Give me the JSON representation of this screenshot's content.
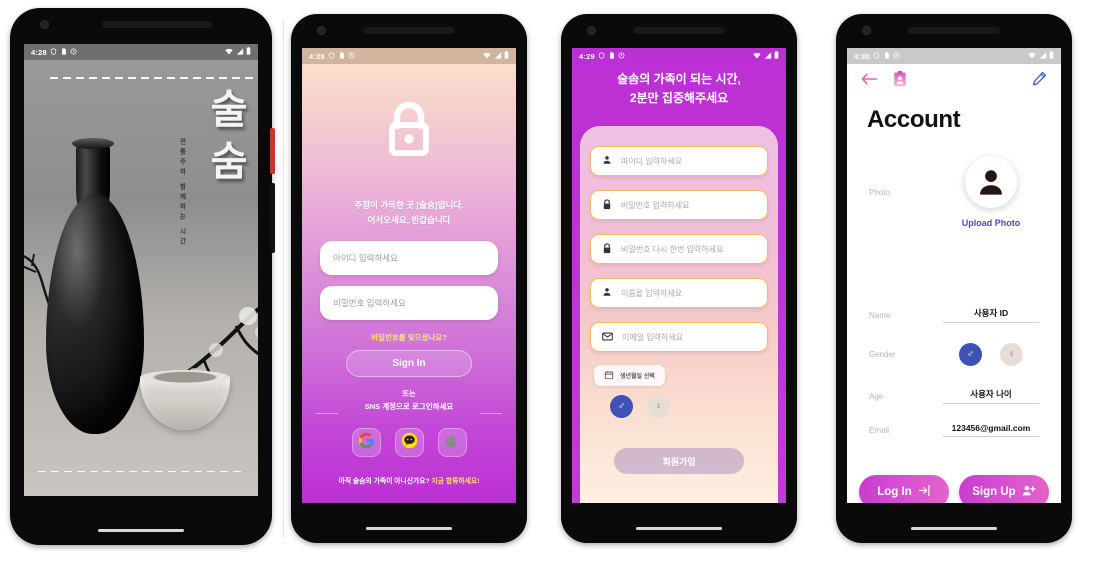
{
  "theme": {
    "accent_magenta": "#bb2fd4",
    "accent_pink": "#e463c8",
    "accent_gold": "#f6bf56",
    "link_blue": "#4a48c4",
    "male_blue": "#3f51b5",
    "female_beige": "#e8ddd6"
  },
  "phone1": {
    "name": "splash-screen",
    "status": {
      "time": "4:28",
      "icons": [
        "shield-icon",
        "sim-icon",
        "sync-icon"
      ],
      "right_icons": [
        "wifi-icon",
        "signal-icon",
        "battery-icon"
      ]
    },
    "brand_title": "술숨",
    "brand_subtitle": "전통주와 함께하는 시간"
  },
  "phone2": {
    "name": "sign-in-screen",
    "status": {
      "time": "4:28",
      "icons": [
        "shield-icon",
        "sim-icon",
        "sync-icon"
      ],
      "right_icons": [
        "wifi-icon",
        "signal-icon",
        "battery-icon"
      ]
    },
    "lock_icon": "lock-icon",
    "welcome_line1": "주향이 가득한 곳 [술숨]입니다.",
    "welcome_line2": "어서오세요, 반갑습니다",
    "id_placeholder": "아이디 입력하세요",
    "pw_placeholder": "비밀번호 입력하세요",
    "forgot_password": "비밀번호를 잊으셨나요?",
    "sign_in_button": "Sign In",
    "or_text": "또는",
    "sns_text": "SNS 계정으로 로그인하세요",
    "social_buttons": [
      {
        "name": "google-icon",
        "label": "Google"
      },
      {
        "name": "kakao-icon",
        "label": "Kakao"
      },
      {
        "name": "apple-icon",
        "label": "Apple"
      }
    ],
    "join_prompt": "아직 술숨의 가족이 아니신가요? ",
    "join_link": "지금 합류하세요!"
  },
  "phone3": {
    "name": "sign-up-screen",
    "status": {
      "time": "4:29",
      "icons": [
        "shield-icon",
        "sim-icon",
        "sync-icon"
      ],
      "right_icons": [
        "wifi-icon",
        "signal-icon",
        "battery-icon"
      ]
    },
    "header_line1": "술솜의 가족이 되는 시간,",
    "header_line2": "2분만 집중해주세요",
    "fields": [
      {
        "icon": "person-icon",
        "placeholder": "마이디 입력하세요"
      },
      {
        "icon": "lock-icon",
        "placeholder": "비밀번호 입력하세요"
      },
      {
        "icon": "lock-icon",
        "placeholder": "비밀번호 다시 한번 입력하세요"
      },
      {
        "icon": "person-icon",
        "placeholder": "이름을 입력하세요"
      },
      {
        "icon": "mail-icon",
        "placeholder": "이메일 입력하세요"
      }
    ],
    "date_button": "생년월일 선택",
    "date_icon": "calendar-icon",
    "gender_male": "♂",
    "gender_female": "♀",
    "submit_button": "회원가입"
  },
  "phone4": {
    "name": "account-screen",
    "status": {
      "time": "4:30",
      "icons": [
        "shield-icon",
        "sim-icon",
        "sync-icon"
      ],
      "right_icons": [
        "wifi-icon",
        "signal-icon",
        "battery-icon"
      ]
    },
    "back_icon": "back-arrow-icon",
    "badge_icon": "id-card-icon",
    "edit_icon": "pencil-edit-icon",
    "title": "Account",
    "photo_label": "Photo",
    "avatar_icon": "person-avatar-icon",
    "upload_photo": "Upload Photo",
    "rows": [
      {
        "label": "Name",
        "value": "사용자 ID"
      },
      {
        "label": "Age",
        "value": "사용자 나이"
      },
      {
        "label": "Email",
        "value": "123456@gmail.com"
      }
    ],
    "gender_label": "Gender",
    "gender_male": "♂",
    "gender_female": "♀",
    "login_button": "Log In",
    "login_icon": "login-arrow-icon",
    "signup_button": "Sign Up",
    "signup_icon": "add-person-icon"
  }
}
